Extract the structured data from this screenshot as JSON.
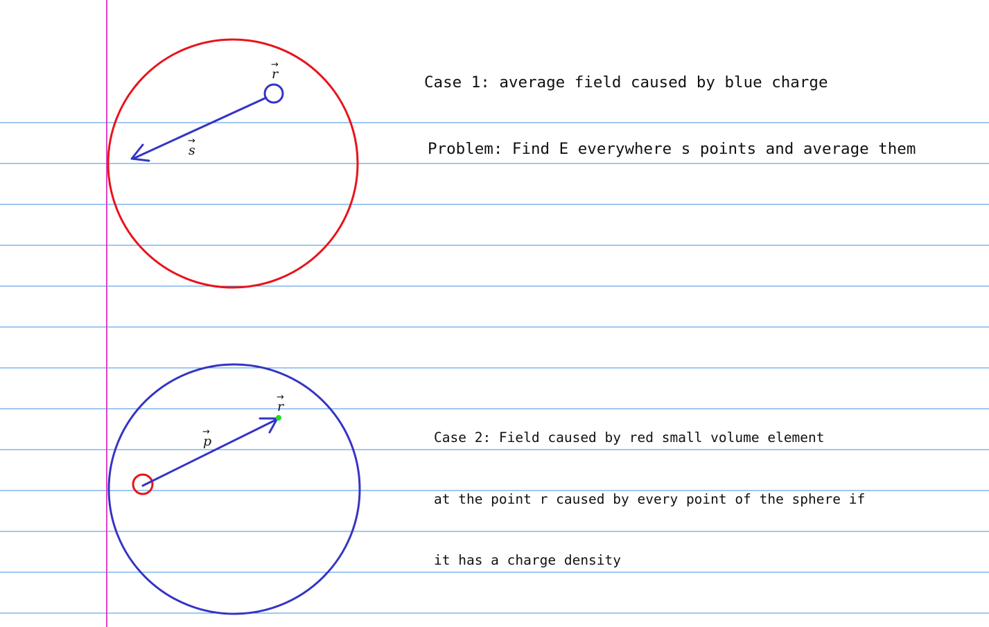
{
  "colors": {
    "paper": "#ffffff",
    "ruled_line": "#3f8fe0",
    "margin_line": "#e040c8",
    "red_ink": "#e8131b",
    "blue_ink": "#3434c4",
    "green_point": "#22dd22"
  },
  "case1": {
    "heading": "Case 1: average field caused by blue charge",
    "problem": "Problem: Find E everywhere s points and average them",
    "vector_labels": {
      "r": "r",
      "s": "s"
    }
  },
  "case2": {
    "lines": [
      "Case 2: Field caused by red small volume element",
      "at the point r caused by every point of the sphere if",
      "it has a charge density"
    ],
    "vector_labels": {
      "r": "r",
      "p": "p"
    }
  }
}
